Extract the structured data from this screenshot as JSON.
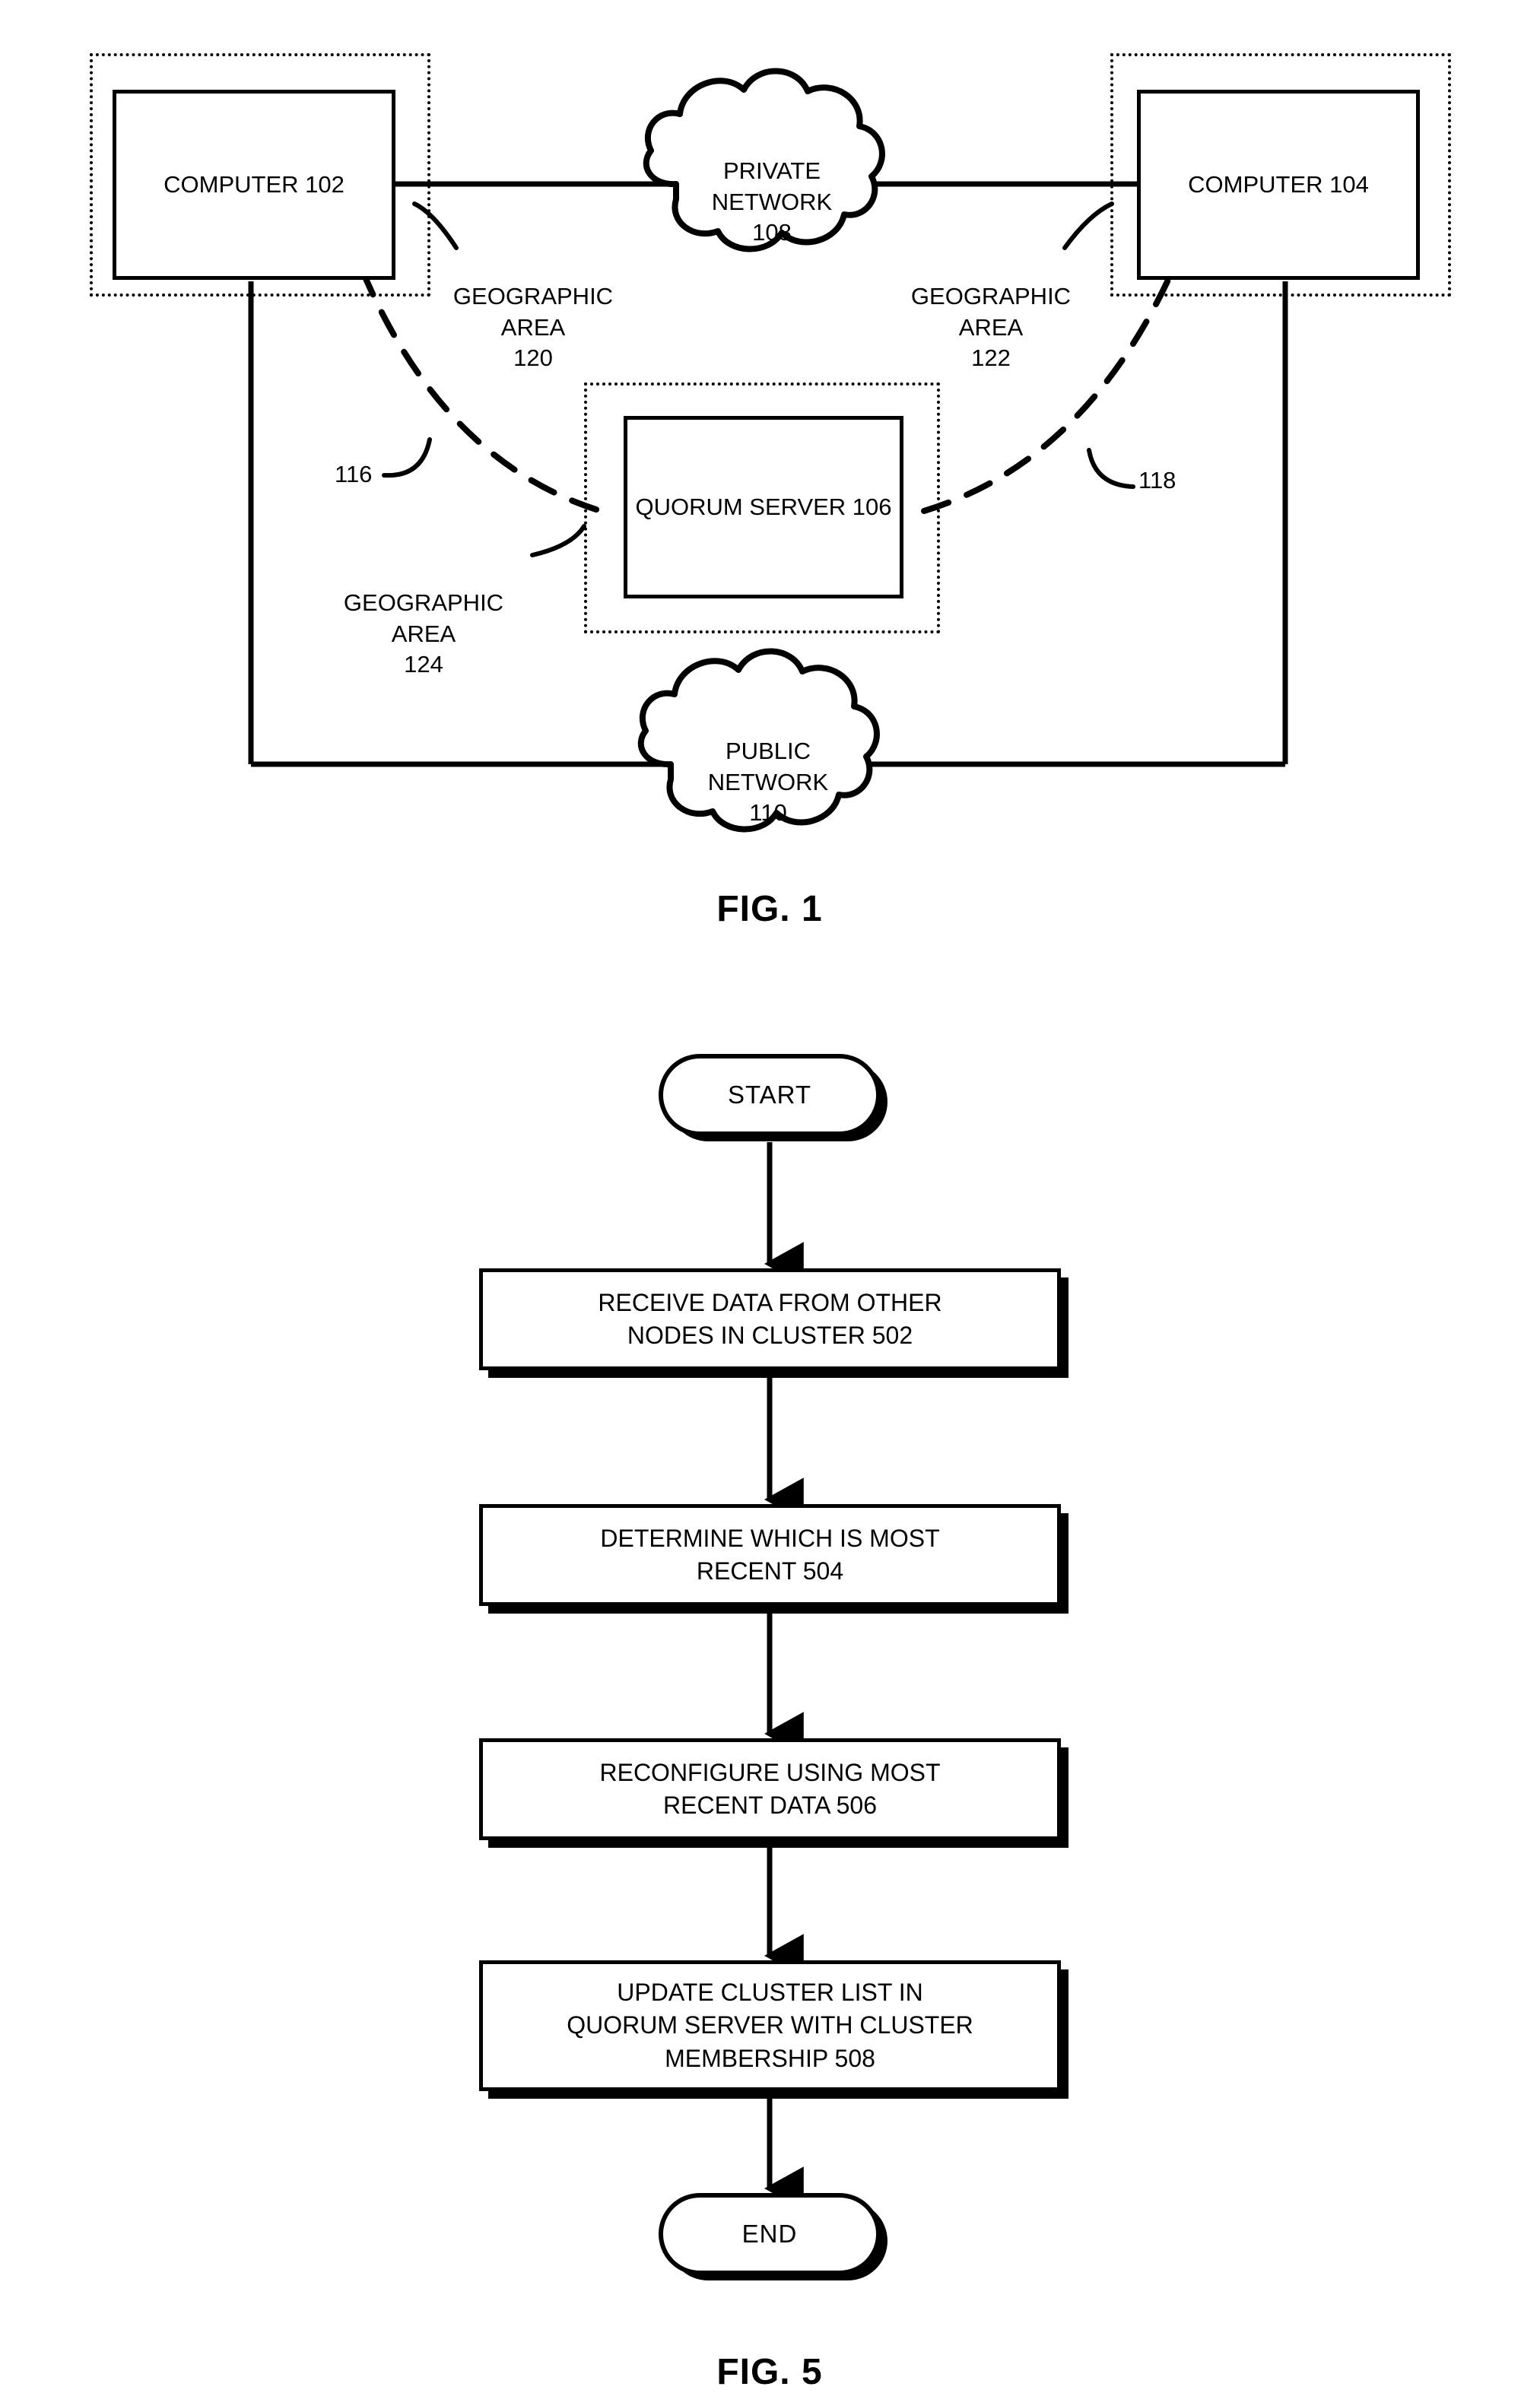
{
  "document": {
    "type": "patent-figure-sheet",
    "figures": [
      "FIG. 1",
      "FIG. 5"
    ]
  },
  "fig1": {
    "caption": "FIG. 1",
    "nodes": {
      "computer_left": "COMPUTER 102",
      "computer_right": "COMPUTER 104",
      "quorum_server": "QUORUM\nSERVER 106"
    },
    "clouds": {
      "private_network": "PRIVATE\nNETWORK\n108",
      "public_network": "PUBLIC\nNETWORK\n110"
    },
    "regions": {
      "geo_area_120": "GEOGRAPHIC\nAREA\n120",
      "geo_area_122": "GEOGRAPHIC\nAREA\n122",
      "geo_area_124": "GEOGRAPHIC\nAREA\n124"
    },
    "leaders": {
      "link_116": "116",
      "link_118": "118"
    }
  },
  "fig5": {
    "caption": "FIG. 5",
    "start": "START",
    "end": "END",
    "steps": [
      "RECEIVE DATA FROM OTHER\nNODES IN CLUSTER 502",
      "DETERMINE WHICH IS MOST\nRECENT 504",
      "RECONFIGURE USING MOST\nRECENT DATA 506",
      "UPDATE CLUSTER LIST IN\nQUORUM SERVER WITH CLUSTER\nMEMBERSHIP 508"
    ]
  },
  "colors": {
    "ink": "#000000",
    "paper": "#ffffff"
  }
}
